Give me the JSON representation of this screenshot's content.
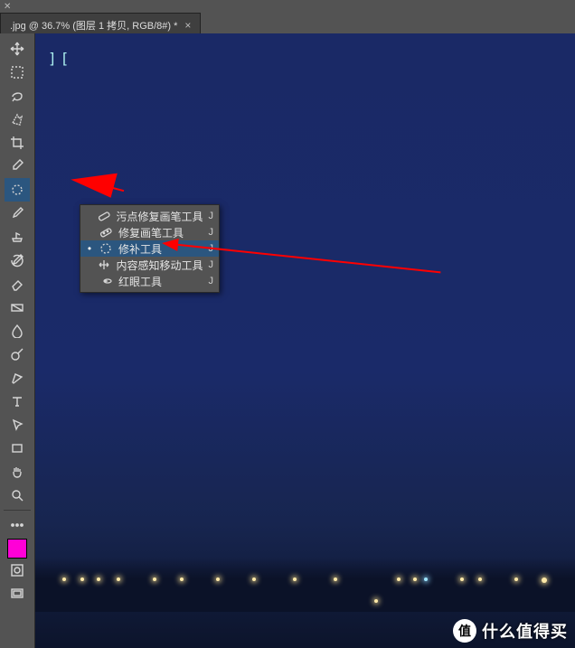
{
  "tab": {
    "title": ".jpg @ 36.7% (图层 1 拷贝, RGB/8#) *"
  },
  "tools": [
    {
      "name": "move-tool"
    },
    {
      "name": "rect-marquee-tool"
    },
    {
      "name": "lasso-tool"
    },
    {
      "name": "quick-select-tool"
    },
    {
      "name": "crop-tool"
    },
    {
      "name": "eyedropper-tool"
    },
    {
      "name": "healing-brush-tool",
      "active": true
    },
    {
      "name": "brush-tool"
    },
    {
      "name": "clone-stamp-tool"
    },
    {
      "name": "history-brush-tool"
    },
    {
      "name": "eraser-tool"
    },
    {
      "name": "gradient-tool"
    },
    {
      "name": "blur-tool"
    },
    {
      "name": "dodge-tool"
    },
    {
      "name": "pen-tool"
    },
    {
      "name": "type-tool"
    },
    {
      "name": "path-select-tool"
    },
    {
      "name": "rectangle-shape-tool"
    },
    {
      "name": "hand-tool"
    },
    {
      "name": "zoom-tool"
    }
  ],
  "healing_flyout": {
    "shortcut": "J",
    "items": [
      {
        "label": "污点修复画笔工具",
        "selected": false,
        "name": "spot-healing-brush-tool"
      },
      {
        "label": "修复画笔工具",
        "selected": false,
        "name": "healing-brush-tool-item"
      },
      {
        "label": "修补工具",
        "selected": true,
        "name": "patch-tool"
      },
      {
        "label": "内容感知移动工具",
        "selected": false,
        "name": "content-aware-move-tool"
      },
      {
        "label": "红眼工具",
        "selected": false,
        "name": "red-eye-tool"
      }
    ]
  },
  "canvas": {
    "marker_text": "]["
  },
  "watermark": {
    "badge": "值",
    "text": "什么值得买"
  }
}
